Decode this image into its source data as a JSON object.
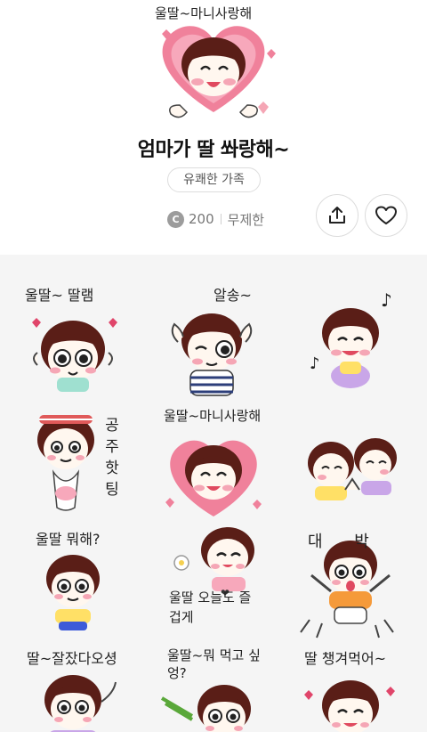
{
  "cover": {
    "caption": "울딸~마니사랑해"
  },
  "product": {
    "title": "엄마가 딸 쏴랑해~",
    "tag": "유쾌한 가족",
    "coin_symbol": "C",
    "price": "200",
    "period": "무제한"
  },
  "icons": {
    "share": "share-icon",
    "like": "heart-outline-icon",
    "coin": "coin-icon"
  },
  "colors": {
    "hair": "#5a1e17",
    "skin": "#fff7ef",
    "cheek": "#f5a6b5",
    "heart": "#f0819b",
    "grid_bg": "#f5f5f5"
  },
  "stickers": [
    {
      "caption": "울딸~ 딸램"
    },
    {
      "caption": "알송~"
    },
    {
      "caption": ""
    },
    {
      "caption": "공주핫팅"
    },
    {
      "caption": "울딸~마니사랑해"
    },
    {
      "caption": ""
    },
    {
      "caption": "울딸 뭐해?"
    },
    {
      "caption": "울딸 오늘도 즐겁게"
    },
    {
      "caption": "대 박"
    },
    {
      "caption": "딸~잘잤다오셩"
    },
    {
      "caption": "울딸~뭐 먹고 싶엉?"
    },
    {
      "caption": "딸 챙겨먹어~"
    }
  ]
}
